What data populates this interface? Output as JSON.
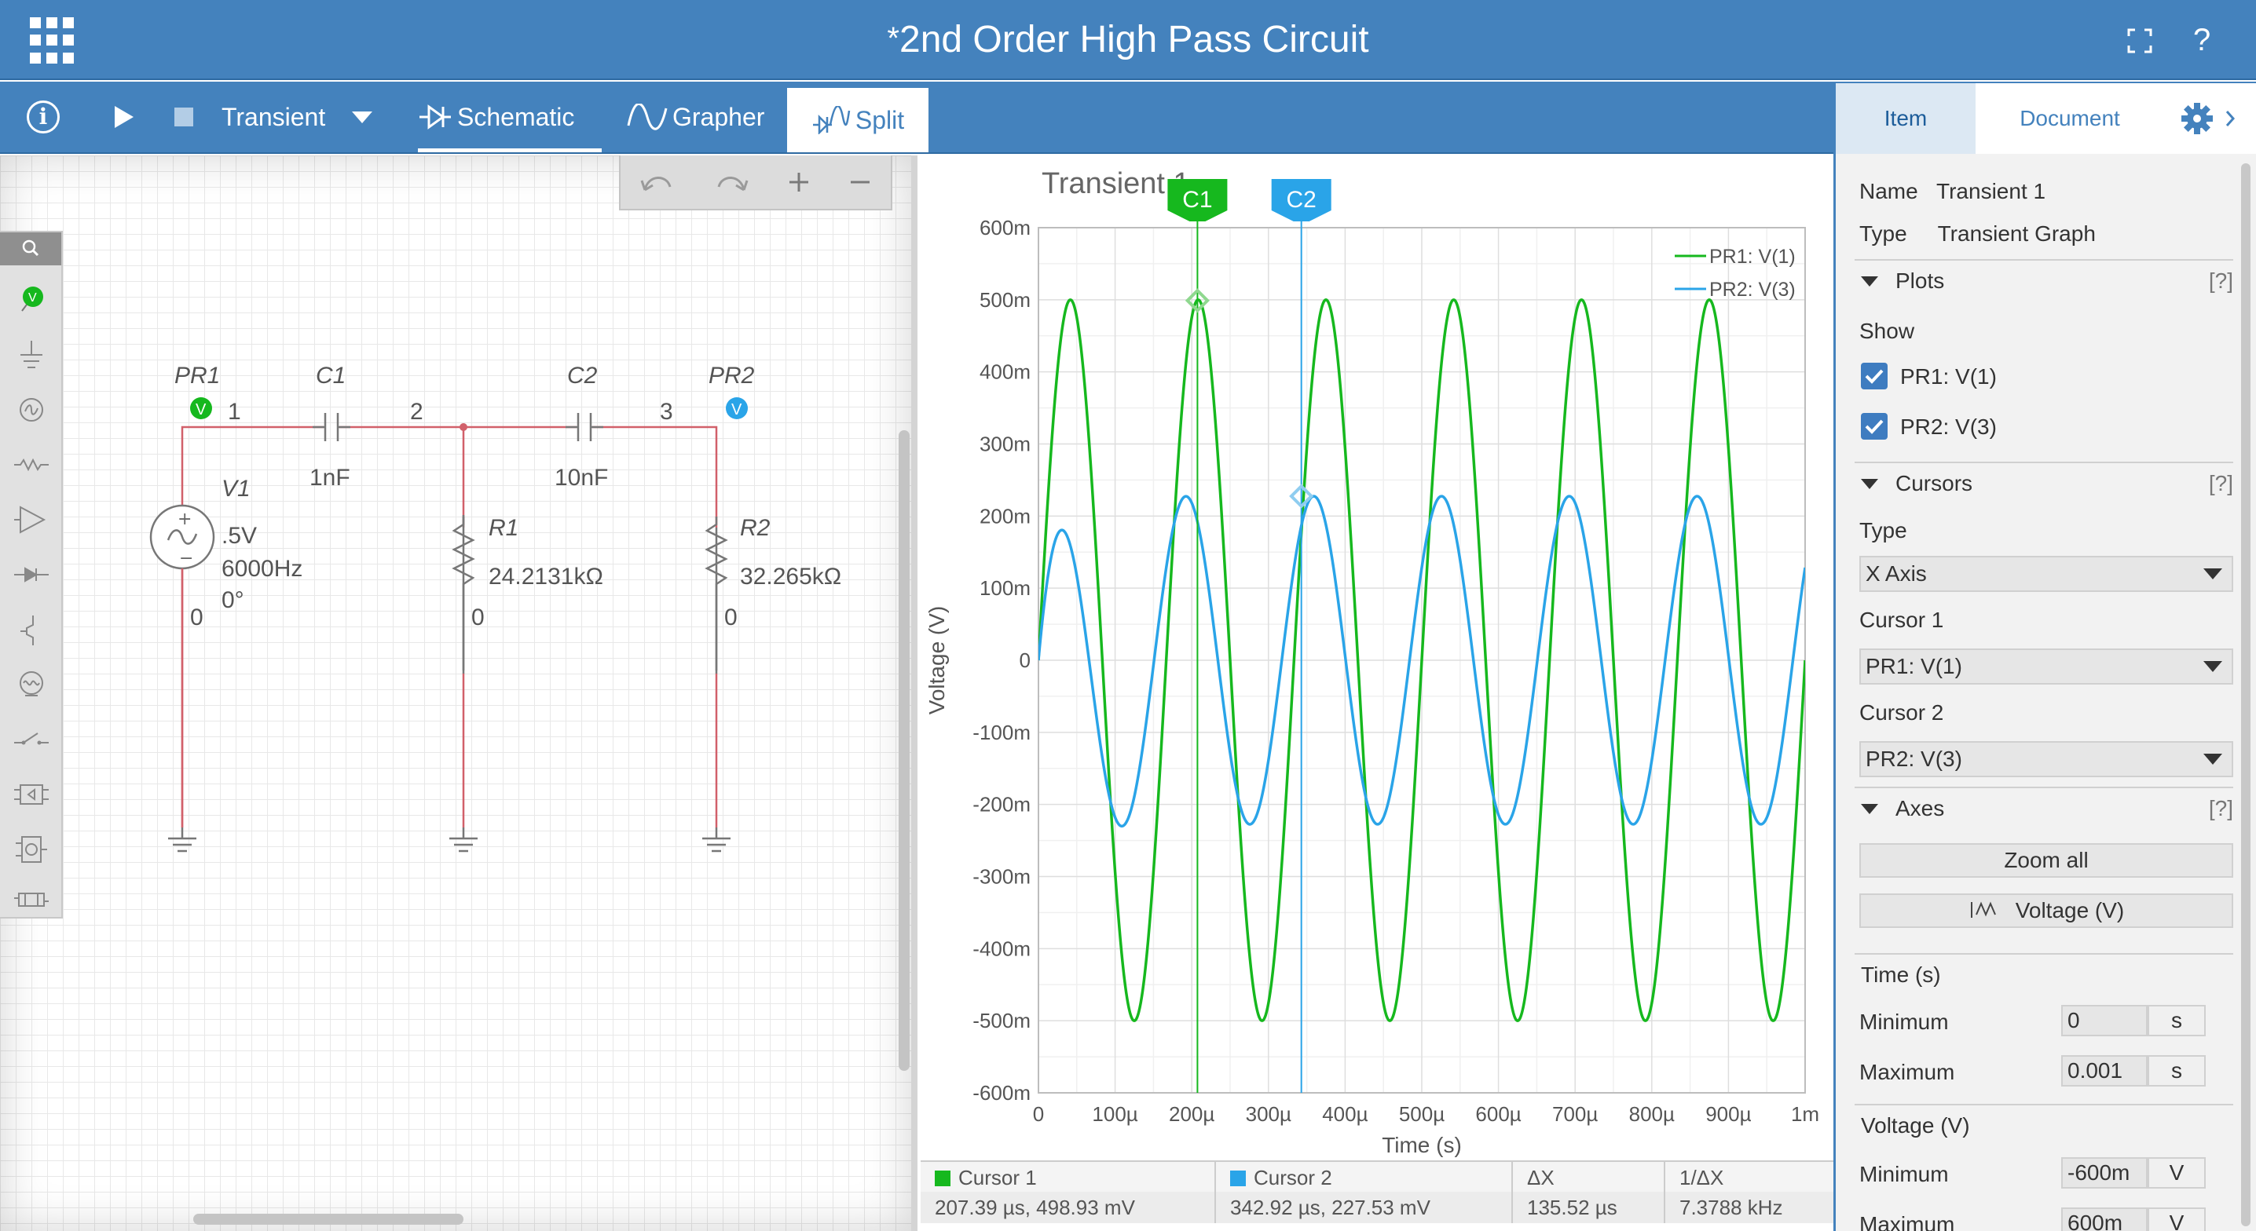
{
  "app": {
    "title": "2nd Order High Pass Circuit",
    "unsaved_marker": "*",
    "help_label": "?"
  },
  "toolbar": {
    "analysis": "Transient",
    "tabs": [
      {
        "label": "Schematic"
      },
      {
        "label": "Grapher"
      },
      {
        "label": "Split",
        "active": true
      }
    ]
  },
  "colors": {
    "header_blue": "#4482bd",
    "trace_green": "#16b81e",
    "trace_blue": "#2aa4e8",
    "wire_red": "#d1606a"
  },
  "schematic": {
    "parts": {
      "pr1": {
        "name": "PR1",
        "node": "1",
        "badge": "V"
      },
      "c1": {
        "name": "C1",
        "value": "1nF"
      },
      "node2": "2",
      "c2": {
        "name": "C2",
        "value": "10nF"
      },
      "node3": "3",
      "pr2": {
        "name": "PR2",
        "badge": "V"
      },
      "v1": {
        "name": "V1",
        "amplitude": ".5V",
        "frequency": "6000Hz",
        "phase": "0°",
        "ground": "0"
      },
      "r1": {
        "name": "R1",
        "value": "24.2131kΩ",
        "ground": "0"
      },
      "r2": {
        "name": "R2",
        "value": "32.265kΩ",
        "ground": "0"
      }
    },
    "palette_badge": "V"
  },
  "chart_data": {
    "type": "line",
    "title": "Transient 1",
    "xlabel": "Time (s)",
    "ylabel": "Voltage (V)",
    "xlim": [
      0,
      0.001
    ],
    "ylim": [
      -0.6,
      0.6
    ],
    "x_ticks": [
      "0",
      "100µ",
      "200µ",
      "300µ",
      "400µ",
      "500µ",
      "600µ",
      "700µ",
      "800µ",
      "900µ",
      "1m"
    ],
    "y_ticks": [
      "600m",
      "500m",
      "400m",
      "300m",
      "200m",
      "100m",
      "0",
      "-100m",
      "-200m",
      "-300m",
      "-400m",
      "-500m",
      "-600m"
    ],
    "grid": true,
    "legend_position": "top-right",
    "series": [
      {
        "name": "PR1: V(1)",
        "color": "#16b81e",
        "kind": "sine",
        "amplitude": 0.5,
        "frequency_hz": 6000,
        "phase_deg": 0
      },
      {
        "name": "PR2: V(3)",
        "color": "#2aa4e8",
        "kind": "sine_with_transient",
        "amplitude": 0.2275,
        "frequency_hz": 6000,
        "steady_phase_deg": 34.4
      }
    ],
    "cursors": [
      {
        "name": "C1",
        "x": 0.00020739,
        "color": "#16b81e",
        "marker_y": 0.49893
      },
      {
        "name": "C2",
        "x": 0.00034292,
        "color": "#2aa4e8",
        "marker_y": 0.22753
      }
    ]
  },
  "cursor_table": {
    "headers": [
      "Cursor 1",
      "Cursor 2",
      "ΔX",
      "1/ΔX"
    ],
    "values": [
      "207.39 µs, 498.93 mV",
      "342.92 µs, 227.53 mV",
      "135.52 µs",
      "7.3788 kHz"
    ]
  },
  "props": {
    "tabs": {
      "item": "Item",
      "document": "Document"
    },
    "name_label": "Name",
    "name_value": "Transient 1",
    "type_label": "Type",
    "type_value": "Transient Graph",
    "plots_header": "Plots",
    "help": "[?]",
    "show_label": "Show",
    "plot1": "PR1: V(1)",
    "plot2": "PR2: V(3)",
    "cursors_header": "Cursors",
    "cursor_type_label": "Type",
    "cursor_type_value": "X Axis",
    "cursor1_label": "Cursor 1",
    "cursor1_value": "PR1: V(1)",
    "cursor2_label": "Cursor 2",
    "cursor2_value": "PR2: V(3)",
    "axes_header": "Axes",
    "zoom_all": "Zoom all",
    "y_axis_button": "Voltage (V)",
    "time_header": "Time (s)",
    "time_min_label": "Minimum",
    "time_min": "0",
    "time_min_unit": "s",
    "time_max_label": "Maximum",
    "time_max": "0.001",
    "time_max_unit": "s",
    "volt_header": "Voltage (V)",
    "volt_min_label": "Minimum",
    "volt_min": "-600m",
    "volt_min_unit": "V",
    "volt_max_label": "Maximum",
    "volt_max": "600m",
    "volt_max_unit": "V"
  }
}
